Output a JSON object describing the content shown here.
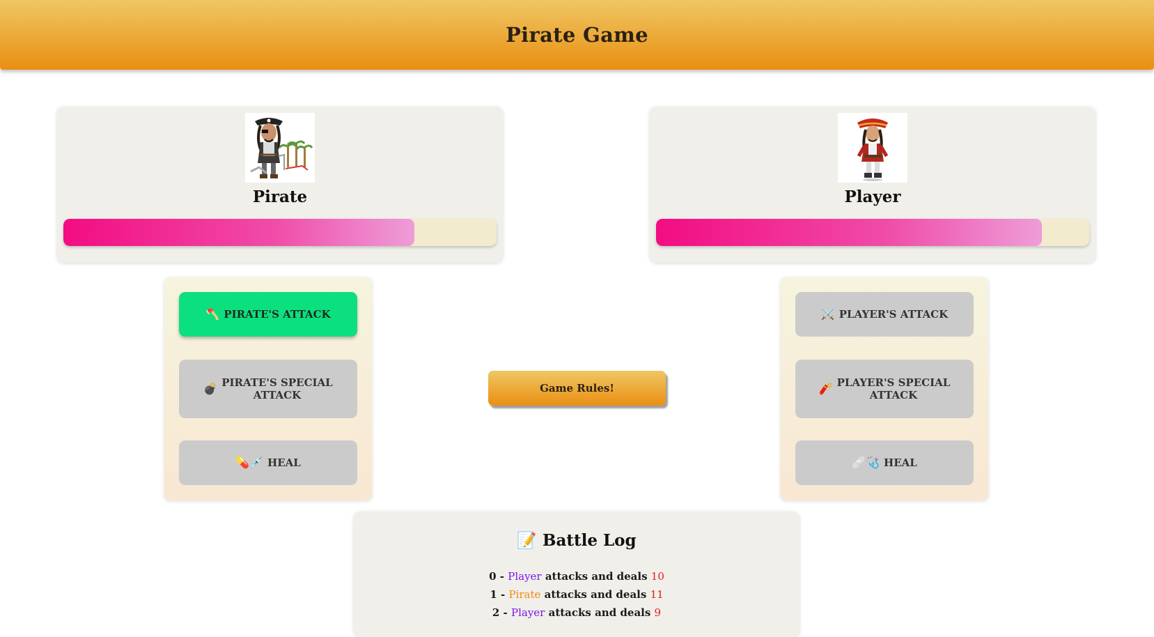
{
  "header": {
    "title": "Pirate Game"
  },
  "pirate": {
    "name": "Pirate",
    "health_fraction": 0.81,
    "avatar_icon": "pirate-character-icon",
    "actions": {
      "attack": {
        "label": "PIRATE'S ATTACK",
        "icon": "🪓",
        "active": true
      },
      "special": {
        "label_line1": "PIRATE'S SPECIAL",
        "label_line2": "ATTACK",
        "icon": "💣"
      },
      "heal": {
        "label": "HEAL",
        "icon": "💊💉"
      }
    }
  },
  "player": {
    "name": "Player",
    "health_fraction": 0.89,
    "avatar_icon": "player-captain-icon",
    "actions": {
      "attack": {
        "label": "PLAYER'S ATTACK",
        "icon": "⚔️"
      },
      "special": {
        "label_line1": "PLAYER'S SPECIAL",
        "label_line2": "ATTACK",
        "icon": "🧨"
      },
      "heal": {
        "label": "HEAL",
        "icon": "🩹🩺"
      }
    }
  },
  "rules_button": {
    "label": "Game Rules!"
  },
  "battle_log": {
    "icon": "📝",
    "title": "Battle Log",
    "entries": [
      {
        "index": "0",
        "who": "Player",
        "text": "attacks and deals",
        "damage": "10"
      },
      {
        "index": "1",
        "who": "Pirate",
        "text": "attacks and deals",
        "damage": "11"
      },
      {
        "index": "2",
        "who": "Player",
        "text": "attacks and deals",
        "damage": "9"
      }
    ]
  },
  "colors": {
    "header_top": "#efc764",
    "header_bottom": "#ea8f12",
    "health_start": "#f30c82",
    "health_end": "#ee9dd8",
    "active_button": "#0ce07e",
    "player_text": "#7a17e6",
    "pirate_text": "#f28a12",
    "damage_text": "#e51c1c"
  }
}
